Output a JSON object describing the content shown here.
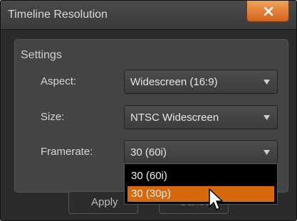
{
  "window": {
    "title": "Timeline Resolution"
  },
  "settings": {
    "title": "Settings",
    "aspect": {
      "label": "Aspect:",
      "value": "Widescreen (16:9)"
    },
    "size": {
      "label": "Size:",
      "value": "NTSC Widescreen"
    },
    "framerate": {
      "label": "Framerate:",
      "value": "30 (60i)"
    }
  },
  "dropdown": {
    "options": [
      "30 (60i)",
      "30 (30p)"
    ],
    "highlighted": "30 (30p)"
  },
  "buttons": {
    "apply": "Apply",
    "cancel": "Cancel"
  },
  "colors": {
    "accent": "#d4690e",
    "close_button": "#e07a30"
  }
}
